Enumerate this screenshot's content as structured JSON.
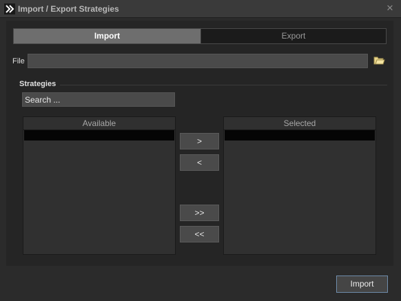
{
  "window": {
    "title": "Import / Export Strategies",
    "close_symbol": "✕",
    "app_icon": "double-chevron-right-icon"
  },
  "tabs": [
    {
      "label": "Import",
      "selected": true
    },
    {
      "label": "Export",
      "selected": false
    }
  ],
  "file": {
    "label": "File",
    "value": "",
    "browse_icon": "folder-icon"
  },
  "strategies": {
    "title": "Strategies",
    "search_placeholder": "Search ...",
    "available_header": "Available",
    "selected_header": "Selected"
  },
  "move_buttons": {
    "add": ">",
    "remove": "<",
    "add_all": ">>",
    "remove_all": "<<"
  },
  "actions": {
    "primary_label": "Import"
  },
  "colors": {
    "background": "#2b2b2b",
    "panel": "#252525",
    "active_tab": "#6e6e6e",
    "primary_border": "#6f8dac",
    "folder": "#e8d48a"
  }
}
